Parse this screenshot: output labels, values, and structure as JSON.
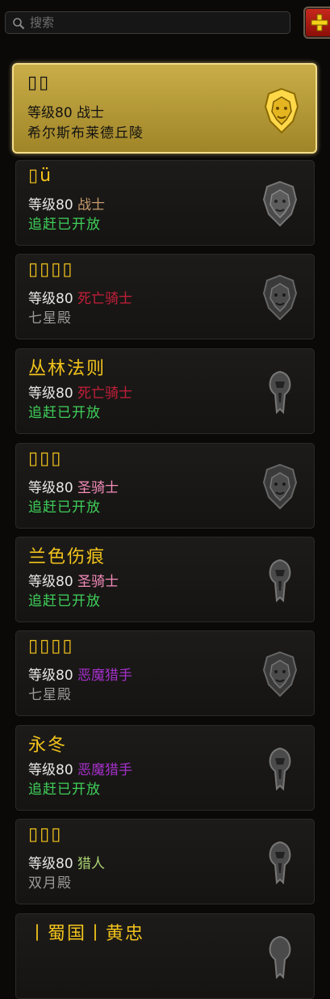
{
  "search": {
    "placeholder": "搜索"
  },
  "add_button_icon": "plus-icon",
  "colors": {
    "name": "#f2c31c",
    "catchup": "#3fcf5a",
    "realm": "#9a9a9a",
    "warrior": "#c69b6d",
    "deathknight": "#c41e3a",
    "paladin": "#f48cba",
    "demonhunter": "#a330c9",
    "hunter": "#aad372"
  },
  "characters": [
    {
      "name": "▯▯",
      "level_label": "等级80",
      "class": "战士",
      "class_color": "#111111",
      "subline": "希尔斯布莱德丘陵",
      "sub_color": "#111111",
      "faction": "alliance"
    },
    {
      "name": "▯ü",
      "level_label": "等级80",
      "class": "战士",
      "class_color": "#c69b6d",
      "subline": "追赶已开放",
      "sub_color": "#3fcf5a",
      "faction": "alliance"
    },
    {
      "name": "▯▯▯▯",
      "level_label": "等级80",
      "class": "死亡骑士",
      "class_color": "#c41e3a",
      "subline": "七星殿",
      "sub_color": "#9a9a9a",
      "faction": "alliance"
    },
    {
      "name": "丛林法则",
      "level_label": "等级80",
      "class": "死亡骑士",
      "class_color": "#c41e3a",
      "subline": "追赶已开放",
      "sub_color": "#3fcf5a",
      "faction": "horde"
    },
    {
      "name": "▯▯▯",
      "level_label": "等级80",
      "class": "圣骑士",
      "class_color": "#f48cba",
      "subline": "追赶已开放",
      "sub_color": "#3fcf5a",
      "faction": "alliance"
    },
    {
      "name": "兰色伤痕",
      "level_label": "等级80",
      "class": "圣骑士",
      "class_color": "#f48cba",
      "subline": "追赶已开放",
      "sub_color": "#3fcf5a",
      "faction": "horde"
    },
    {
      "name": "▯▯▯▯",
      "level_label": "等级80",
      "class": "恶魔猎手",
      "class_color": "#a330c9",
      "subline": "七星殿",
      "sub_color": "#9a9a9a",
      "faction": "alliance"
    },
    {
      "name": "永冬",
      "level_label": "等级80",
      "class": "恶魔猎手",
      "class_color": "#a330c9",
      "subline": "追赶已开放",
      "sub_color": "#3fcf5a",
      "faction": "horde"
    },
    {
      "name": "▯▯▯",
      "level_label": "等级80",
      "class": "猎人",
      "class_color": "#aad372",
      "subline": "双月殿",
      "sub_color": "#9a9a9a",
      "faction": "horde"
    },
    {
      "name": "丨蜀国丨黄忠",
      "faction": "horde"
    }
  ]
}
